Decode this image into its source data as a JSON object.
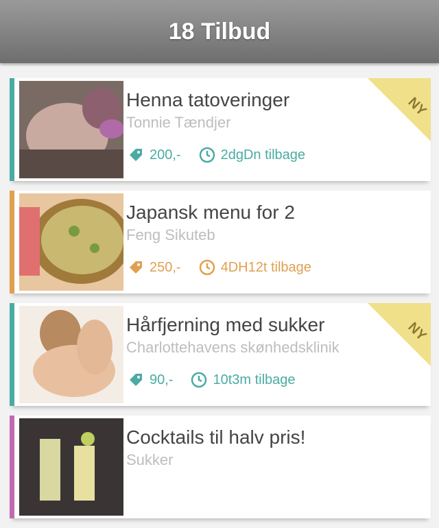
{
  "header": {
    "title": "18 Tilbud"
  },
  "offers": [
    {
      "title": "Henna tatoveringer",
      "subtitle": "Tonnie Tændjer",
      "price": "200,-",
      "time": "2dgDn tilbage",
      "accent": "#4aaba4",
      "corner": true
    },
    {
      "title": "Japansk menu for 2",
      "subtitle": "Feng Sikuteb",
      "price": "250,-",
      "time": "4DH12t tilbage",
      "accent": "#e0a050",
      "corner": false
    },
    {
      "title": "Hårfjerning med sukker",
      "subtitle": "Charlottehavens skønhedsklinik",
      "price": "90,-",
      "time": "10t3m tilbage",
      "accent": "#4aaba4",
      "corner": true
    },
    {
      "title": "Cocktails til halv pris!",
      "subtitle": "Sukker",
      "price": "",
      "time": "",
      "accent": "#c06ab0",
      "corner": false
    }
  ],
  "colors": {
    "header_top": "#9a9a9a",
    "header_bottom": "#6e6e6e",
    "corner_badge": "#f0e08a"
  }
}
